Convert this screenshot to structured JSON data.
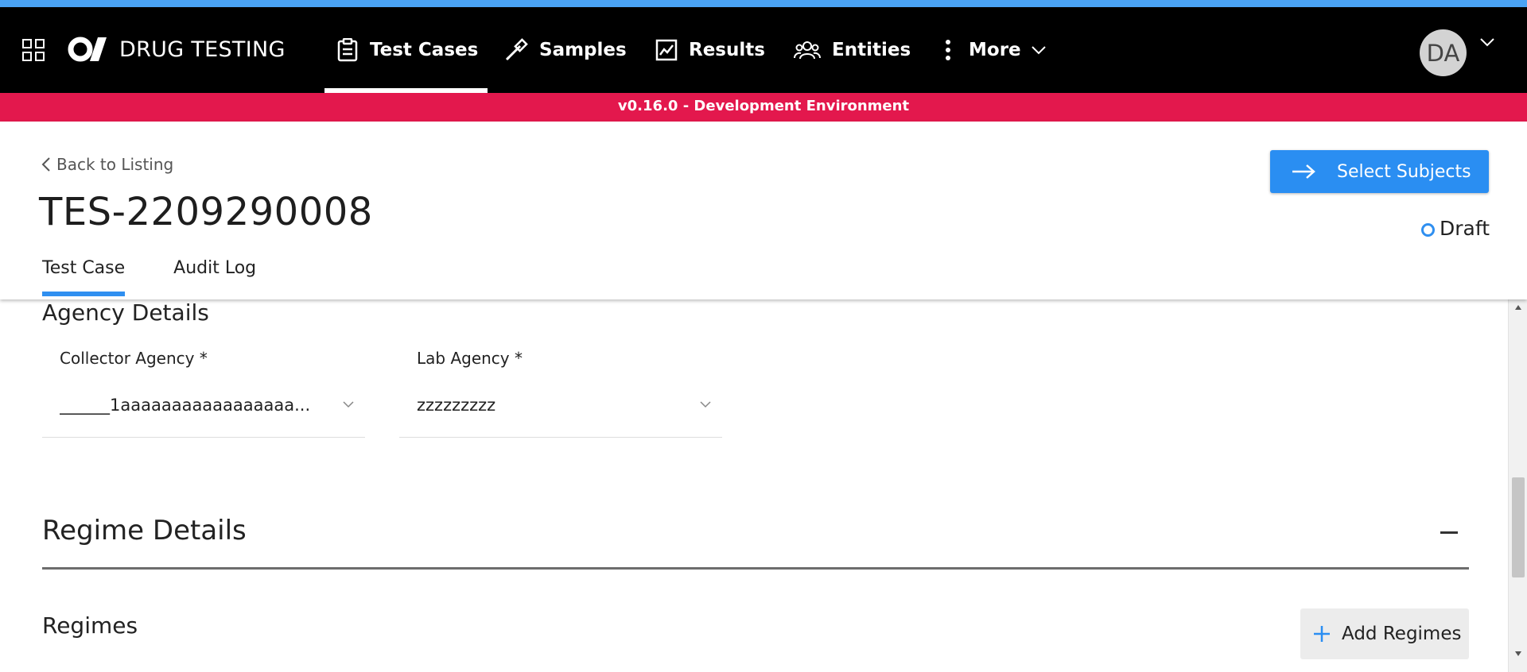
{
  "nav": {
    "menu_icon": "grid-icon",
    "logo": "OI logo",
    "brand": "DRUG TESTING",
    "items": [
      {
        "label": "Test Cases",
        "icon": "clipboard-icon",
        "active": true
      },
      {
        "label": "Samples",
        "icon": "dropper-icon",
        "active": false
      },
      {
        "label": "Results",
        "icon": "chart-icon",
        "active": false
      },
      {
        "label": "Entities",
        "icon": "users-icon",
        "active": false
      },
      {
        "label": "More",
        "icon": "kebab-icon",
        "active": false
      }
    ],
    "avatar_initials": "DA"
  },
  "env_banner": "v0.16.0 - Development Environment",
  "header": {
    "back_label": "Back to Listing",
    "title": "TES-2209290008",
    "primary_action": "Select Subjects",
    "status": "Draft",
    "tabs": [
      "Test Case",
      "Audit Log"
    ],
    "active_tab": "Test Case"
  },
  "agency_section": {
    "title": "Agency Details",
    "fields": [
      {
        "label": "Collector Agency *",
        "value": "______1aaaaaaaaaaaaaaaaa..."
      },
      {
        "label": "Lab Agency *",
        "value": "zzzzzzzzz"
      }
    ]
  },
  "regime_section": {
    "title": "Regime Details",
    "subtitle": "Regimes",
    "add_label": "Add Regimes"
  },
  "colors": {
    "top_strip": "#4aa3f5",
    "navbar": "#000000",
    "env_banner": "#e3184d",
    "accent": "#2a8ef2"
  }
}
